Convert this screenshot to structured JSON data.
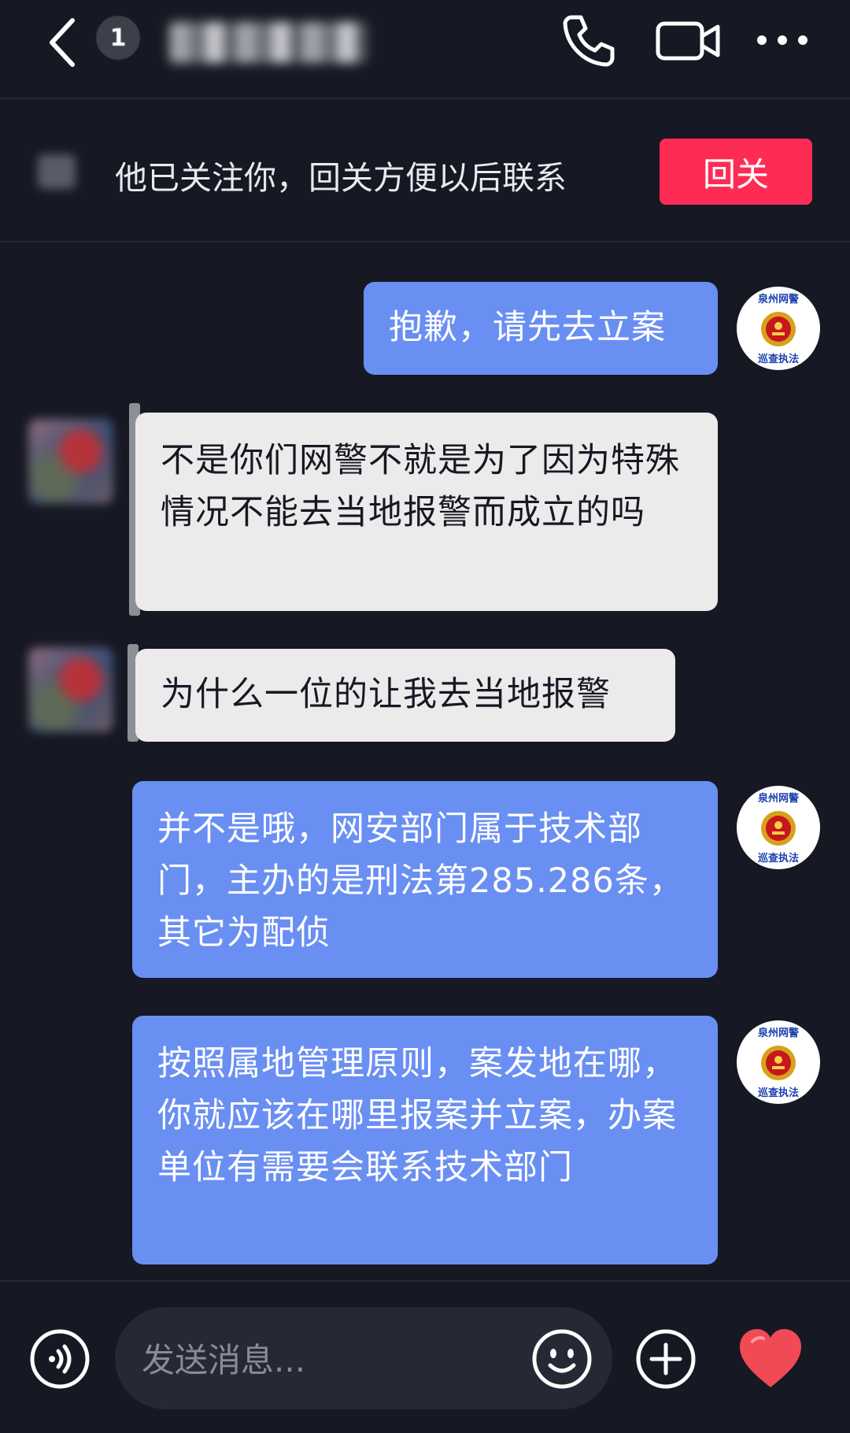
{
  "header": {
    "unread_count": "1",
    "contact_name": "",
    "icons": [
      "back-icon",
      "phone-icon",
      "video-call-icon",
      "more-icon"
    ]
  },
  "banner": {
    "text": "他已关注你，回关方便以后联系",
    "button_label": "回关"
  },
  "messages": [
    {
      "side": "me",
      "text": "抱歉，请先去立案"
    },
    {
      "side": "them",
      "text": "不是你们网警不就是为了因为特殊情况不能去当地报警而成立的吗"
    },
    {
      "side": "them",
      "text": "为什么一位的让我去当地报警"
    },
    {
      "side": "me",
      "text": "并不是哦，网安部门属于技术部门，主办的是刑法第285.286条，其它为配侦"
    },
    {
      "side": "me",
      "text": "按照属地管理原则，案发地在哪，你就应该在哪里报案并立案，办案单位有需要会联系技术部门"
    }
  ],
  "police_avatar": {
    "top_text": "泉州网警",
    "bottom_text": "巡查执法"
  },
  "composer": {
    "placeholder": "发送消息..."
  },
  "colors": {
    "background": "#161823",
    "my_bubble": "#6a8ff3",
    "their_bubble": "#eceaea",
    "follow_button": "#fe2c55",
    "heart": "#f04a55"
  }
}
